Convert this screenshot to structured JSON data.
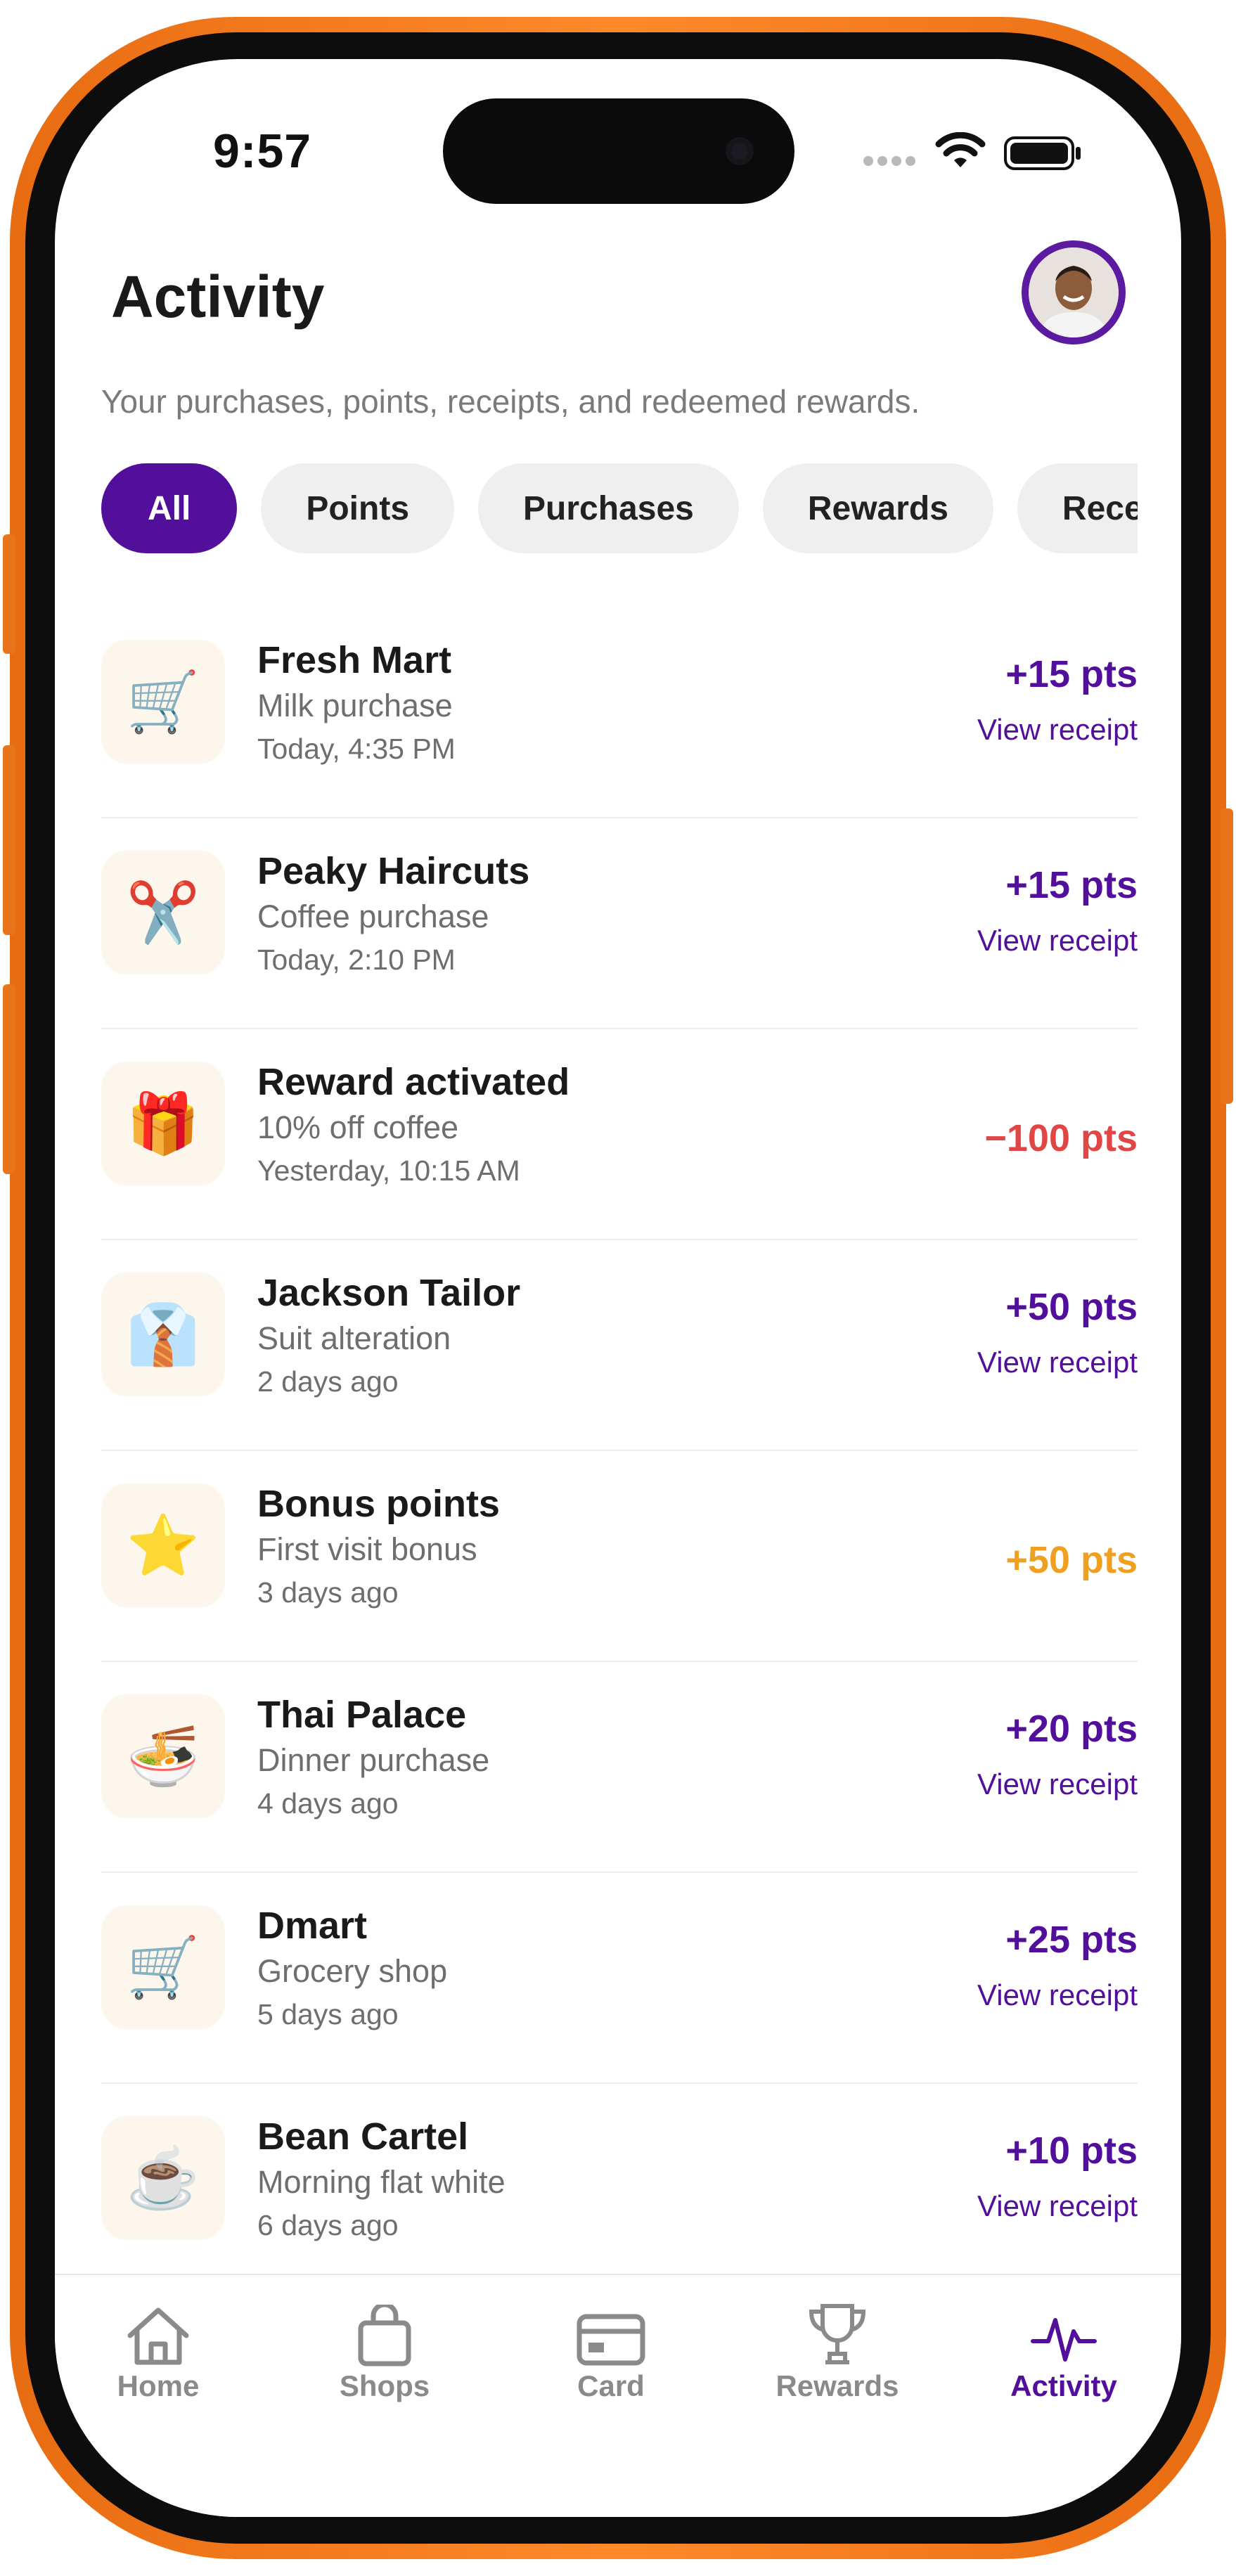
{
  "status_bar": {
    "time": "9:57"
  },
  "header": {
    "title": "Activity",
    "subtitle": "Your purchases, points, receipts, and redeemed rewards."
  },
  "filters": [
    {
      "label": "All",
      "active": true
    },
    {
      "label": "Points",
      "active": false
    },
    {
      "label": "Purchases",
      "active": false
    },
    {
      "label": "Rewards",
      "active": false
    },
    {
      "label": "Receipts",
      "active": false
    }
  ],
  "activity": [
    {
      "title": "Fresh Mart",
      "subtitle": "Milk purchase",
      "time": "Today, 4:35 PM",
      "points": "+15 pts",
      "receipt": "View receipt",
      "icon": "shopping-cart-icon",
      "glyph": "🛒",
      "kind": "purchase"
    },
    {
      "title": "Peaky Haircuts",
      "subtitle": "Coffee purchase",
      "time": "Today, 2:10 PM",
      "points": "+15 pts",
      "receipt": "View receipt",
      "icon": "scissors-icon",
      "glyph": "✂️",
      "kind": "purchase"
    },
    {
      "title": "Reward activated",
      "subtitle": "10% off coffee",
      "time": "Yesterday, 10:15 AM",
      "points": "−100 pts",
      "receipt": "",
      "icon": "gift-icon",
      "glyph": "🎁",
      "kind": "redeem"
    },
    {
      "title": "Jackson Tailor",
      "subtitle": "Suit alteration",
      "time": "2 days ago",
      "points": "+50 pts",
      "receipt": "View receipt",
      "icon": "shirt-tie-icon",
      "glyph": "👔",
      "kind": "purchase"
    },
    {
      "title": "Bonus points",
      "subtitle": "First visit bonus",
      "time": "3 days ago",
      "points": "+50 pts",
      "receipt": "",
      "icon": "star-icon",
      "glyph": "⭐",
      "kind": "bonus"
    },
    {
      "title": "Thai Palace",
      "subtitle": "Dinner purchase",
      "time": "4 days ago",
      "points": "+20 pts",
      "receipt": "View receipt",
      "icon": "noodle-bowl-icon",
      "glyph": "🍜",
      "kind": "purchase"
    },
    {
      "title": "Dmart",
      "subtitle": "Grocery shop",
      "time": "5 days ago",
      "points": "+25 pts",
      "receipt": "View receipt",
      "icon": "shopping-cart-icon",
      "glyph": "🛒",
      "kind": "purchase"
    },
    {
      "title": "Bean Cartel",
      "subtitle": "Morning flat white",
      "time": "6 days ago",
      "points": "+10 pts",
      "receipt": "View receipt",
      "icon": "coffee-cup-icon",
      "glyph": "☕",
      "kind": "purchase"
    }
  ],
  "tabs": [
    {
      "label": "Home",
      "icon": "home-icon",
      "active": false
    },
    {
      "label": "Shops",
      "icon": "shopping-bag-icon",
      "active": false
    },
    {
      "label": "Card",
      "icon": "card-icon",
      "active": false
    },
    {
      "label": "Rewards",
      "icon": "trophy-icon",
      "active": false
    },
    {
      "label": "Activity",
      "icon": "activity-icon",
      "active": true
    }
  ],
  "colors": {
    "accent": "#520f9c",
    "negative": "#e04646",
    "bonus": "#f0a020",
    "frame": "#ff8a2a"
  }
}
